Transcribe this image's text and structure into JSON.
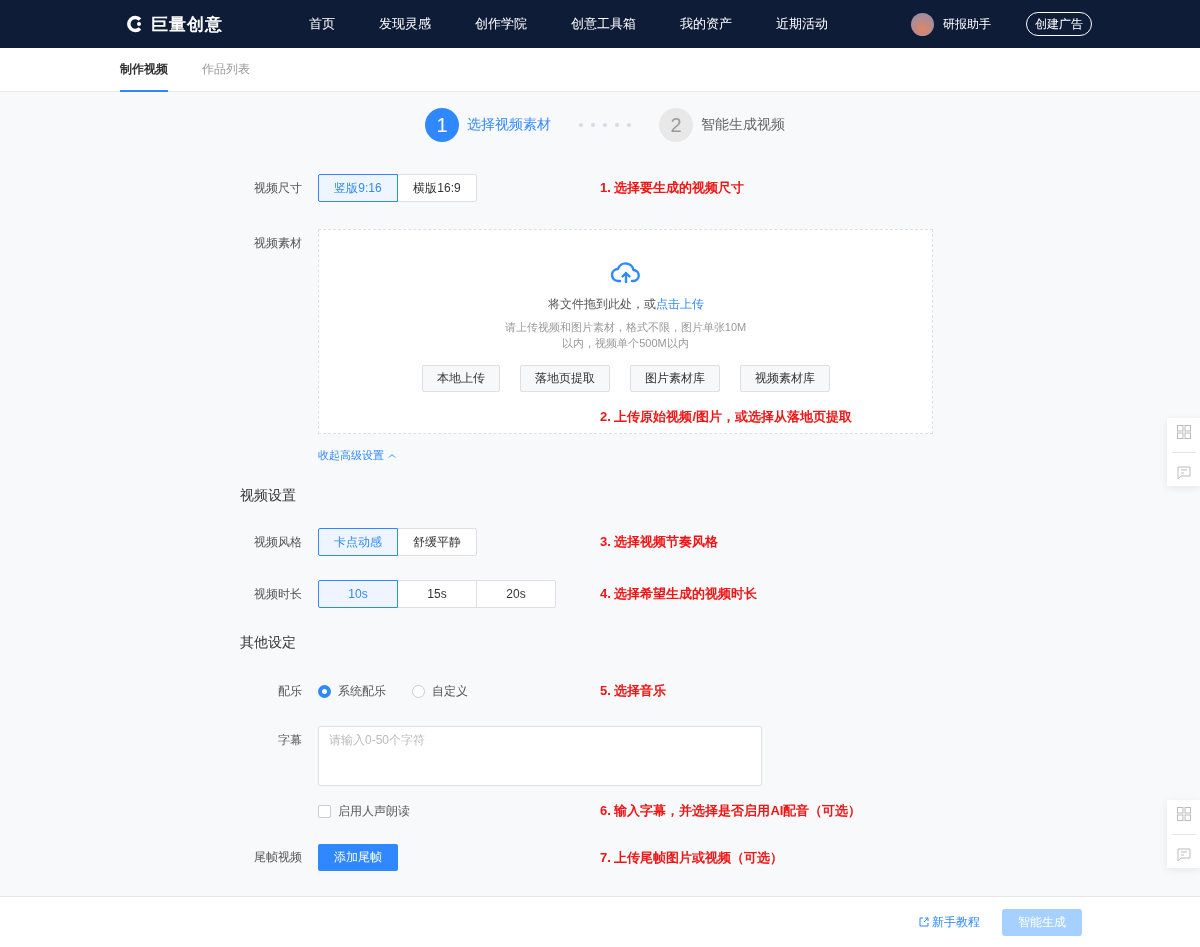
{
  "header": {
    "logo_text": "巨量创意",
    "nav": [
      {
        "label": "首页"
      },
      {
        "label": "发现灵感"
      },
      {
        "label": "创作学院"
      },
      {
        "label": "创意工具箱"
      },
      {
        "label": "我的资产"
      },
      {
        "label": "近期活动"
      }
    ],
    "user_name": "研报助手",
    "create_button": "创建广告"
  },
  "tabs": [
    {
      "label": "制作视频",
      "selected": true
    },
    {
      "label": "作品列表",
      "selected": false
    }
  ],
  "steps": [
    {
      "number": "1",
      "label": "选择视频素材",
      "active": true
    },
    {
      "number": "2",
      "label": "智能生成视频",
      "active": false
    }
  ],
  "size": {
    "label": "视频尺寸",
    "options": [
      {
        "label": "竖版9:16",
        "selected": true
      },
      {
        "label": "横版16:9",
        "selected": false
      }
    ],
    "annotation": "1. 选择要生成的视频尺寸"
  },
  "material": {
    "label": "视频素材",
    "drop_text": "将文件拖到此处，或",
    "drop_link": "点击上传",
    "hint": "请上传视频和图片素材，格式不限，图片单张10M以内，视频单个500M以内",
    "buttons": [
      "本地上传",
      "落地页提取",
      "图片素材库",
      "视频素材库"
    ],
    "annotation": "2. 上传原始视频/图片，或选择从落地页提取"
  },
  "collapse_link": "收起高级设置",
  "video_settings": {
    "heading": "视频设置",
    "style": {
      "label": "视频风格",
      "options": [
        {
          "label": "卡点动感",
          "selected": true
        },
        {
          "label": "舒缓平静",
          "selected": false
        }
      ],
      "annotation": "3. 选择视频节奏风格"
    },
    "duration": {
      "label": "视频时长",
      "options": [
        {
          "label": "10s",
          "selected": true
        },
        {
          "label": "15s",
          "selected": false
        },
        {
          "label": "20s",
          "selected": false
        }
      ],
      "annotation": "4. 选择希望生成的视频时长"
    }
  },
  "other_settings": {
    "heading": "其他设定",
    "music": {
      "label": "配乐",
      "options": [
        {
          "label": "系统配乐",
          "selected": true
        },
        {
          "label": "自定义",
          "selected": false
        }
      ],
      "annotation": "5. 选择音乐"
    },
    "subtitle": {
      "label": "字幕",
      "placeholder": "请输入0-50个字符"
    },
    "voice": {
      "label": "启用人声朗读",
      "checked": false,
      "annotation": "6. 输入字幕，并选择是否启用AI配音（可选）"
    },
    "tail": {
      "label": "尾帧视频",
      "button": "添加尾帧",
      "annotation": "7. 上传尾帧图片或视频（可选）"
    }
  },
  "footer": {
    "tutorial_link": "新手教程",
    "generate_button": "智能生成",
    "generate_disabled": true
  }
}
